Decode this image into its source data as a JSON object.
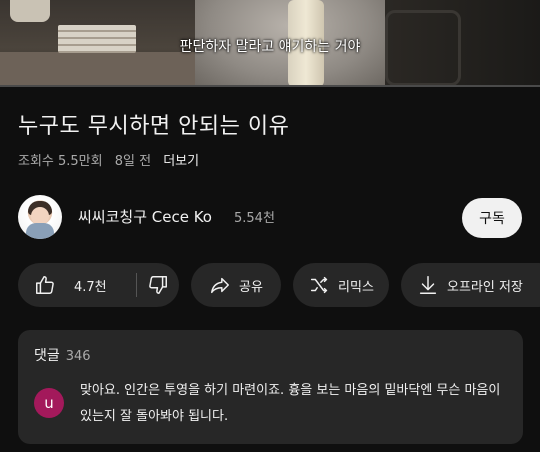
{
  "video": {
    "caption": "판단하자 말라고 얘기하는 거야",
    "progress_fraction": 0.0,
    "colors": {
      "progress": "#ff0000"
    }
  },
  "title": "누구도 무시하면 안되는 이유",
  "meta": {
    "views": "조회수 5.5만회",
    "age": "8일 전",
    "more": "더보기"
  },
  "channel": {
    "name": "씨씨코칭구 Cece Ko",
    "subscribers": "5.54천",
    "subscribe_label": "구독"
  },
  "actions": {
    "like_count": "4.7천",
    "share_label": "공유",
    "remix_label": "리믹스",
    "offline_label": "오프라인 저장"
  },
  "comments": {
    "header": "댓글",
    "count": "346",
    "top_comment": {
      "avatar_letter": "u",
      "avatar_color": "#a3195b",
      "text": "맞아요. 인간은 투영을 하기 마련이죠. 흉을 보는 마음의 밑바닥엔 무슨 마음이 있는지 잘 돌아봐야 됩니다."
    }
  }
}
